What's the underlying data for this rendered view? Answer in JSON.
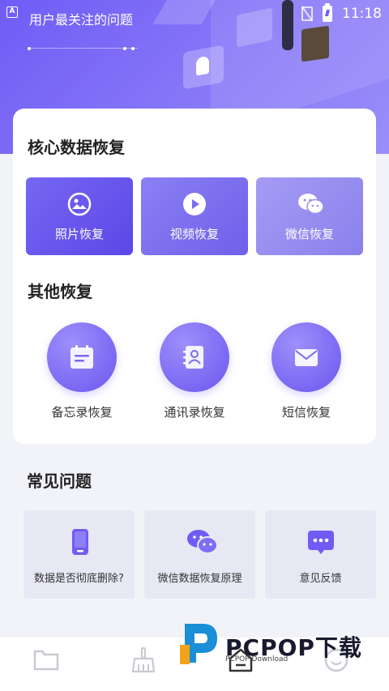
{
  "status_bar": {
    "app_badge": "A",
    "time": "11:18"
  },
  "header": {
    "title": "用户最关注的问题"
  },
  "core_recovery": {
    "title": "核心数据恢复",
    "tiles": [
      {
        "label": "照片恢复",
        "icon": "photo-icon"
      },
      {
        "label": "视频恢复",
        "icon": "video-icon"
      },
      {
        "label": "微信恢复",
        "icon": "wechat-icon"
      }
    ]
  },
  "other_recovery": {
    "title": "其他恢复",
    "items": [
      {
        "label": "备忘录恢复",
        "icon": "memo-icon"
      },
      {
        "label": "通讯录恢复",
        "icon": "contacts-icon"
      },
      {
        "label": "短信恢复",
        "icon": "sms-icon"
      }
    ]
  },
  "faq": {
    "title": "常见问题",
    "items": [
      {
        "label": "数据是否彻底删除?",
        "icon": "phone-icon"
      },
      {
        "label": "微信数据恢复原理",
        "icon": "chat-bubbles-icon"
      },
      {
        "label": "意见反馈",
        "icon": "feedback-icon"
      }
    ]
  },
  "bottom_nav": [
    "folder-icon",
    "broom-icon",
    "home-icon",
    "smiley-icon"
  ],
  "watermark": {
    "brand": "PCPOP下载",
    "sub": "PCPOP Download"
  },
  "colors": {
    "accent": "#6f5cf5",
    "faq_card": "#e7e8f4",
    "background": "#f2f3f8"
  }
}
